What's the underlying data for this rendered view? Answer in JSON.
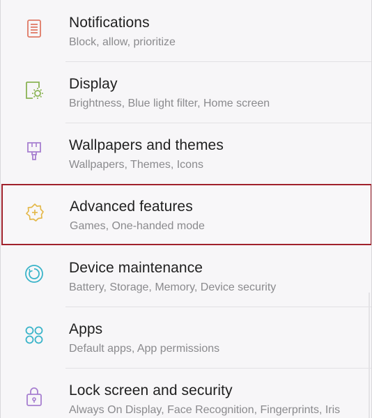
{
  "settings": {
    "items": [
      {
        "title": "Notifications",
        "subtitle": "Block, allow, prioritize",
        "icon": "notifications-icon",
        "color": "#e07a65"
      },
      {
        "title": "Display",
        "subtitle": "Brightness, Blue light filter, Home screen",
        "icon": "display-brightness-icon",
        "color": "#8bb455"
      },
      {
        "title": "Wallpapers and themes",
        "subtitle": "Wallpapers, Themes, Icons",
        "icon": "paintbrush-icon",
        "color": "#a77fd0"
      },
      {
        "title": "Advanced features",
        "subtitle": "Games, One-handed mode",
        "icon": "gear-plus-icon",
        "color": "#e4b94c"
      },
      {
        "title": "Device maintenance",
        "subtitle": "Battery, Storage, Memory, Device security",
        "icon": "refresh-circle-icon",
        "color": "#3ab4c9"
      },
      {
        "title": "Apps",
        "subtitle": "Default apps, App permissions",
        "icon": "apps-grid-icon",
        "color": "#3ab4c9"
      },
      {
        "title": "Lock screen and security",
        "subtitle": "Always On Display, Face Recognition, Fingerprints, Iris",
        "icon": "lock-icon",
        "color": "#a77fd0"
      }
    ],
    "highlight_color": "#a0212c"
  }
}
